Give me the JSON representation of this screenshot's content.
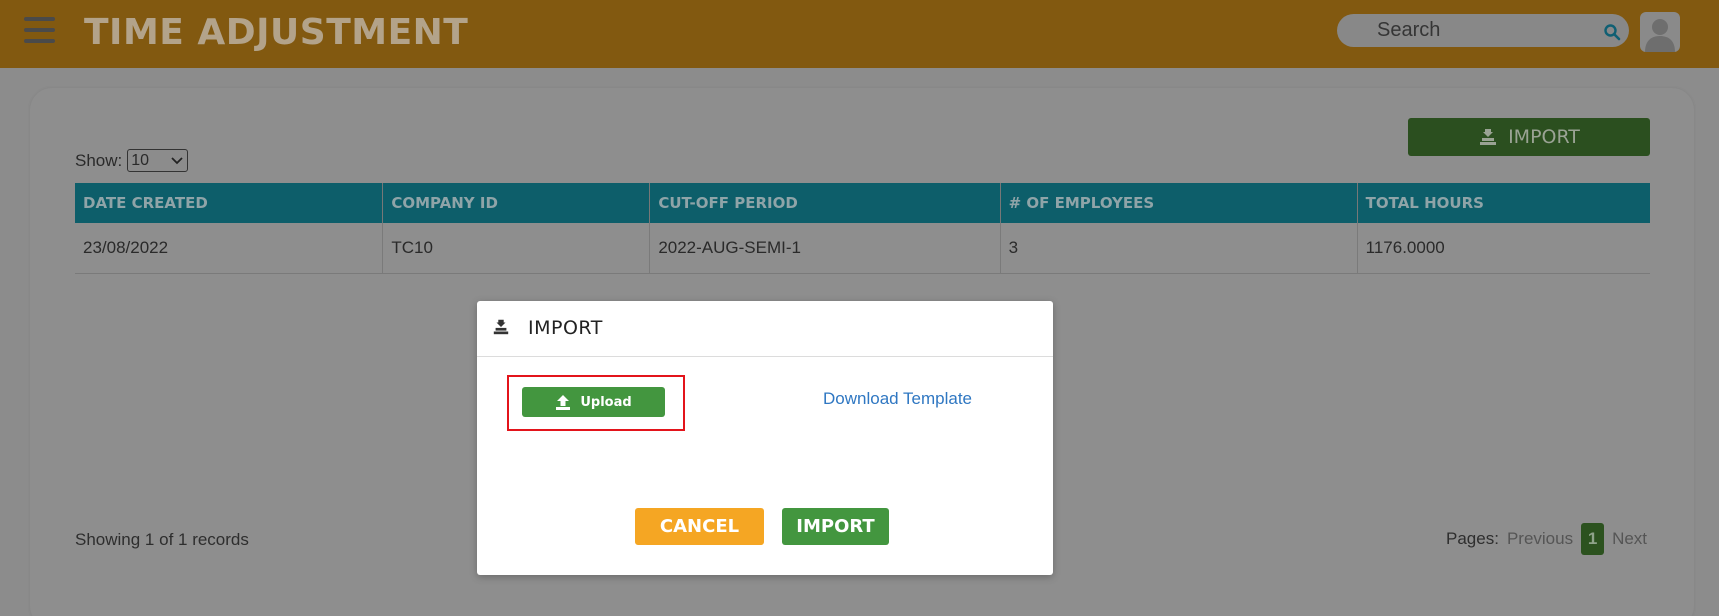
{
  "header": {
    "title": "TIME ADJUSTMENT",
    "search_placeholder": "Search"
  },
  "toolbar": {
    "import_label": "IMPORT",
    "show_label": "Show:",
    "show_value": "10"
  },
  "table": {
    "columns": [
      "DATE CREATED",
      "COMPANY ID",
      "CUT-OFF PERIOD",
      "# OF EMPLOYEES",
      "TOTAL HOURS"
    ],
    "rows": [
      [
        "23/08/2022",
        "TC10",
        "2022-AUG-SEMI-1",
        "3",
        "1176.0000"
      ]
    ]
  },
  "footer": {
    "showing_text": "Showing 1 of 1 records",
    "pages_label": "Pages:",
    "previous_label": "Previous",
    "current_page": "1",
    "next_label": "Next"
  },
  "modal": {
    "title": "IMPORT",
    "upload_label": "Upload",
    "download_template_label": "Download Template",
    "cancel_label": "CANCEL",
    "import_label": "IMPORT"
  },
  "colors": {
    "header_bg": "#825910",
    "table_header_bg": "#0d5e6a",
    "import_green": "#43963f",
    "cancel_orange": "#f5a623",
    "highlight_red": "#e3141b",
    "link_blue": "#2f77c2"
  },
  "icons": {
    "menu": "hamburger-icon",
    "search": "search-icon",
    "avatar": "user-avatar-icon",
    "import": "import-icon",
    "upload": "upload-icon"
  }
}
